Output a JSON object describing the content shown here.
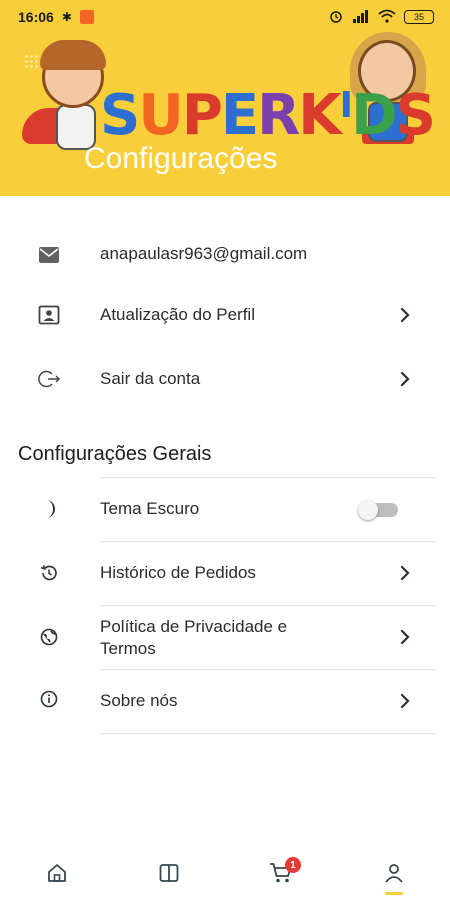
{
  "status_bar": {
    "time": "16:06",
    "battery": "35"
  },
  "header": {
    "logo_text": [
      "S",
      "U",
      "P",
      "E",
      "R",
      "K",
      "I",
      "D",
      "S"
    ],
    "logo_colors": [
      "#2d6fd1",
      "#f26522",
      "#d93c2c",
      "#2d6fd1",
      "#7b3fb0",
      "#d93c2c",
      "#2d6fd1",
      "#3aa14a",
      "#d93c2c"
    ],
    "title": "Configurações"
  },
  "account": {
    "email": "anapaulasr963@gmail.com",
    "profile_update": "Atualização do Perfil",
    "logout": "Sair da conta"
  },
  "general": {
    "section_title": "Configurações Gerais",
    "dark_theme": "Tema Escuro",
    "dark_theme_enabled": false,
    "order_history": "Histórico de Pedidos",
    "privacy_line1": "Política de Privacidade e",
    "privacy_line2": "Termos",
    "about": "Sobre nós"
  },
  "nav": {
    "items": [
      "home-icon",
      "catalog-icon",
      "cart-icon",
      "profile-icon"
    ],
    "cart_count": "1",
    "active": "profile",
    "accent_color": "#f8cf3a"
  }
}
